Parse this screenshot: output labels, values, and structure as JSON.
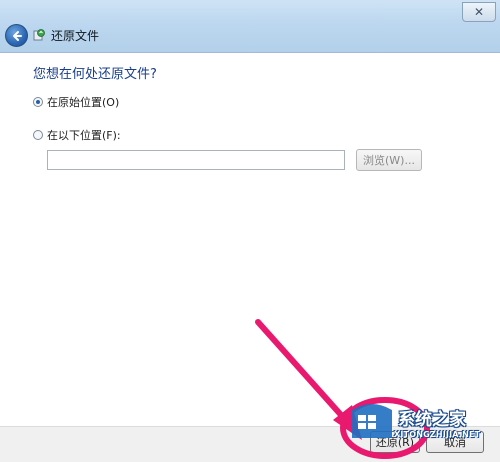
{
  "window": {
    "title": "还原文件",
    "close_glyph": "✕"
  },
  "content": {
    "heading": "您想在何处还原文件?",
    "option_original": "在原始位置(O)",
    "option_following": "在以下位置(F):",
    "path_value": "",
    "browse_label": "浏览(W)..."
  },
  "footer": {
    "restore_label": "还原(R)",
    "cancel_label": "取消"
  },
  "watermark": {
    "name": "系统之家",
    "url": "XITONGZHIJIA.NET"
  },
  "colors": {
    "heading": "#1a3f8a",
    "annotation": "#e8196e"
  }
}
